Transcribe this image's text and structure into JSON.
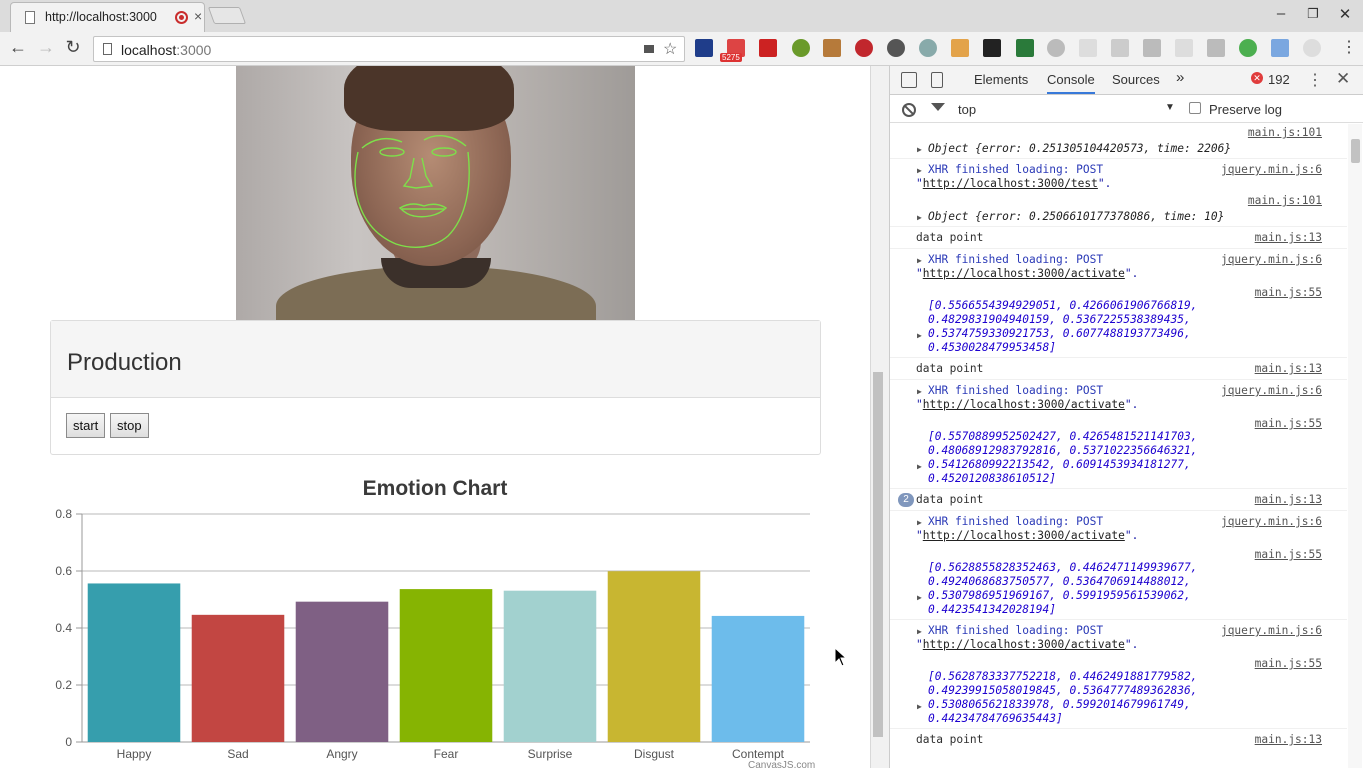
{
  "browser": {
    "tab_title": "http://localhost:3000",
    "url_host": "localhost",
    "url_port": ":3000",
    "extension_badge": "5275"
  },
  "page": {
    "panel_title": "Production",
    "start_label": "start",
    "stop_label": "stop",
    "watermark": "CanvasJS.com"
  },
  "chart_data": {
    "type": "bar",
    "title": "Emotion Chart",
    "categories": [
      "Happy",
      "Sad",
      "Angry",
      "Fear",
      "Surprise",
      "Disgust",
      "Contempt"
    ],
    "values": [
      0.5563,
      0.4462,
      0.4924,
      0.5365,
      0.5309,
      0.5992,
      0.4424
    ],
    "ylim": [
      0,
      0.8
    ],
    "yticks": [
      "0",
      "0.2",
      "0.4",
      "0.6",
      "0.8"
    ],
    "colors": [
      "#369ead",
      "#c24642",
      "#7f6084",
      "#86b402",
      "#a2d1cf",
      "#c8b631",
      "#6dbceb"
    ],
    "grid": true
  },
  "devtools": {
    "tabs": [
      "Elements",
      "Console",
      "Sources"
    ],
    "more": "»",
    "error_count": "192",
    "context": "top",
    "preserve_log": "Preserve log",
    "messages": [
      {
        "src": "main.js:101",
        "text": "",
        "kind": "src-only"
      },
      {
        "src": "",
        "text": "Object {error: 0.251305104420573, time: 2206}",
        "kind": "object"
      },
      {
        "src": "jquery.min.js:6",
        "text": "XHR finished loading: POST",
        "url": "http://localhost:3000/test",
        "kind": "xhr"
      },
      {
        "src": "main.js:101",
        "text": "",
        "kind": "src-only"
      },
      {
        "src": "",
        "text": "Object {error: 0.2506610177378086, time: 10}",
        "kind": "object"
      },
      {
        "src": "main.js:13",
        "text": "data point",
        "kind": "plain"
      },
      {
        "src": "jquery.min.js:6",
        "text": "XHR finished loading: POST",
        "url": "http://localhost:3000/activate",
        "kind": "xhr"
      },
      {
        "src": "main.js:55",
        "text": "[0.5566554394929051, 0.4266061906766819,\n0.4829831904940159, 0.5367225538389435,\n0.5374759330921753, 0.6077488193773496,\n0.4530028479953458]",
        "kind": "array"
      },
      {
        "src": "main.js:13",
        "text": "data point",
        "kind": "plain"
      },
      {
        "src": "jquery.min.js:6",
        "text": "XHR finished loading: POST",
        "url": "http://localhost:3000/activate",
        "kind": "xhr"
      },
      {
        "src": "main.js:55",
        "text": "[0.5570889952502427, 0.4265481521141703,\n0.48068912983792816, 0.5371022356646321,\n0.5412680992213542, 0.6091453934181277,\n0.4520120838610512]",
        "kind": "array"
      },
      {
        "src": "main.js:13",
        "text": "data point",
        "kind": "plain",
        "repeat": "2"
      },
      {
        "src": "jquery.min.js:6",
        "text": "XHR finished loading: POST",
        "url": "http://localhost:3000/activate",
        "kind": "xhr"
      },
      {
        "src": "main.js:55",
        "text": "[0.5628855828352463, 0.4462471149939677,\n0.4924068683750577, 0.5364706914488012,\n0.5307986951969167, 0.5991959561539062,\n0.4423541342028194]",
        "kind": "array"
      },
      {
        "src": "jquery.min.js:6",
        "text": "XHR finished loading: POST",
        "url": "http://localhost:3000/activate",
        "kind": "xhr"
      },
      {
        "src": "main.js:55",
        "text": "[0.5628783337752218, 0.4462491881779582,\n0.49239915058019845, 0.5364777489362836,\n0.5308065621833978, 0.5992014679961749,\n0.44234784769635443]",
        "kind": "array"
      },
      {
        "src": "main.js:13",
        "text": "data point",
        "kind": "plain"
      }
    ]
  }
}
